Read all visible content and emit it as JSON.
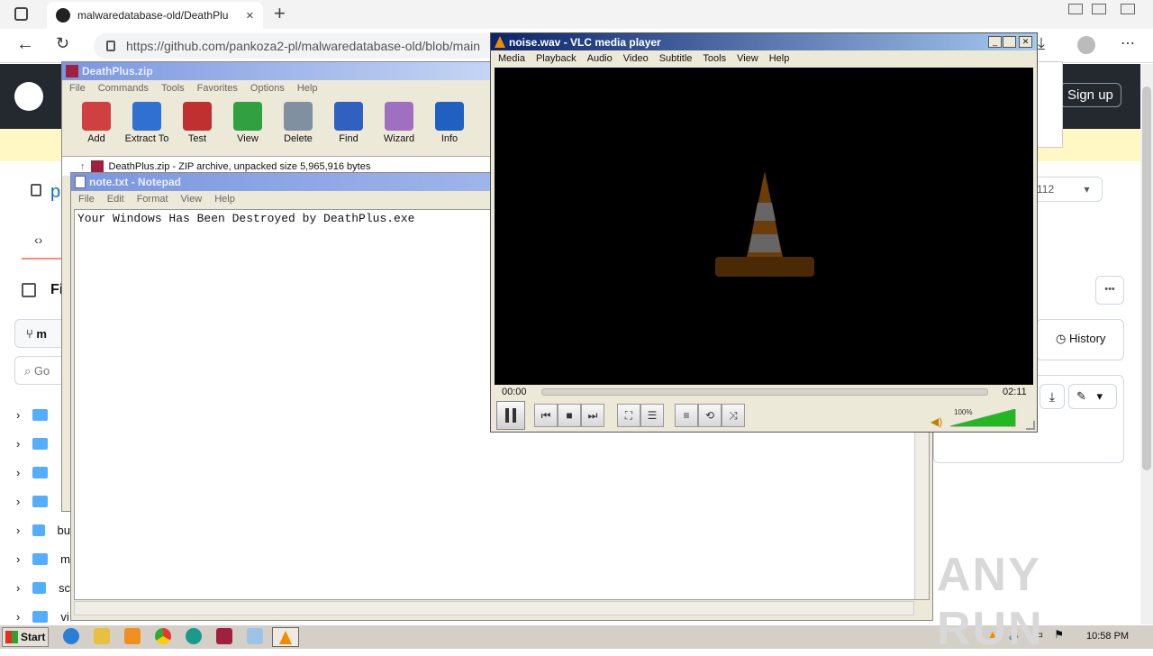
{
  "browser": {
    "tab_title": "malwaredatabase-old/DeathPlu",
    "url": "https://github.com/pankoza2-pl/malwaredatabase-old/blob/main",
    "new_tab": "+",
    "tab_close": "✕"
  },
  "github": {
    "sign_up": "Sign up",
    "repo_fragment": "p",
    "code_fragment": "‹›",
    "files_fragment": "Fi",
    "branch_fragment": "m",
    "goto_fragment": "Go",
    "star_count": "112",
    "history_label": "History",
    "more": "•••",
    "folders": [
      "",
      "",
      "",
      "",
      "bu",
      "m",
      "sc",
      "vi"
    ]
  },
  "winrar": {
    "title": "DeathPlus.zip",
    "menu": [
      "File",
      "Commands",
      "Tools",
      "Favorites",
      "Options",
      "Help"
    ],
    "toolbar": [
      "Add",
      "Extract To",
      "Test",
      "View",
      "Delete",
      "Find",
      "Wizard",
      "Info"
    ],
    "path_text": "DeathPlus.zip - ZIP archive, unpacked size 5,965,916 bytes"
  },
  "notepad": {
    "title": "note.txt - Notepad",
    "menu": [
      "File",
      "Edit",
      "Format",
      "View",
      "Help"
    ],
    "content": "Your Windows Has Been Destroyed by DeathPlus.exe"
  },
  "vlc": {
    "title": "noise.wav - VLC media player",
    "menu": [
      "Media",
      "Playback",
      "Audio",
      "Video",
      "Subtitle",
      "Tools",
      "View",
      "Help"
    ],
    "time_elapsed": "00:00",
    "time_total": "02:11",
    "volume": "100%",
    "volume_fraction": 1.0
  },
  "taskbar": {
    "start": "Start",
    "clock": "10:58 PM"
  },
  "watermark": "ANY RUN",
  "colors": {
    "gh_dark": "#24292f",
    "xp_title": "#0a246a",
    "vlc_orange": "#f08a00"
  }
}
